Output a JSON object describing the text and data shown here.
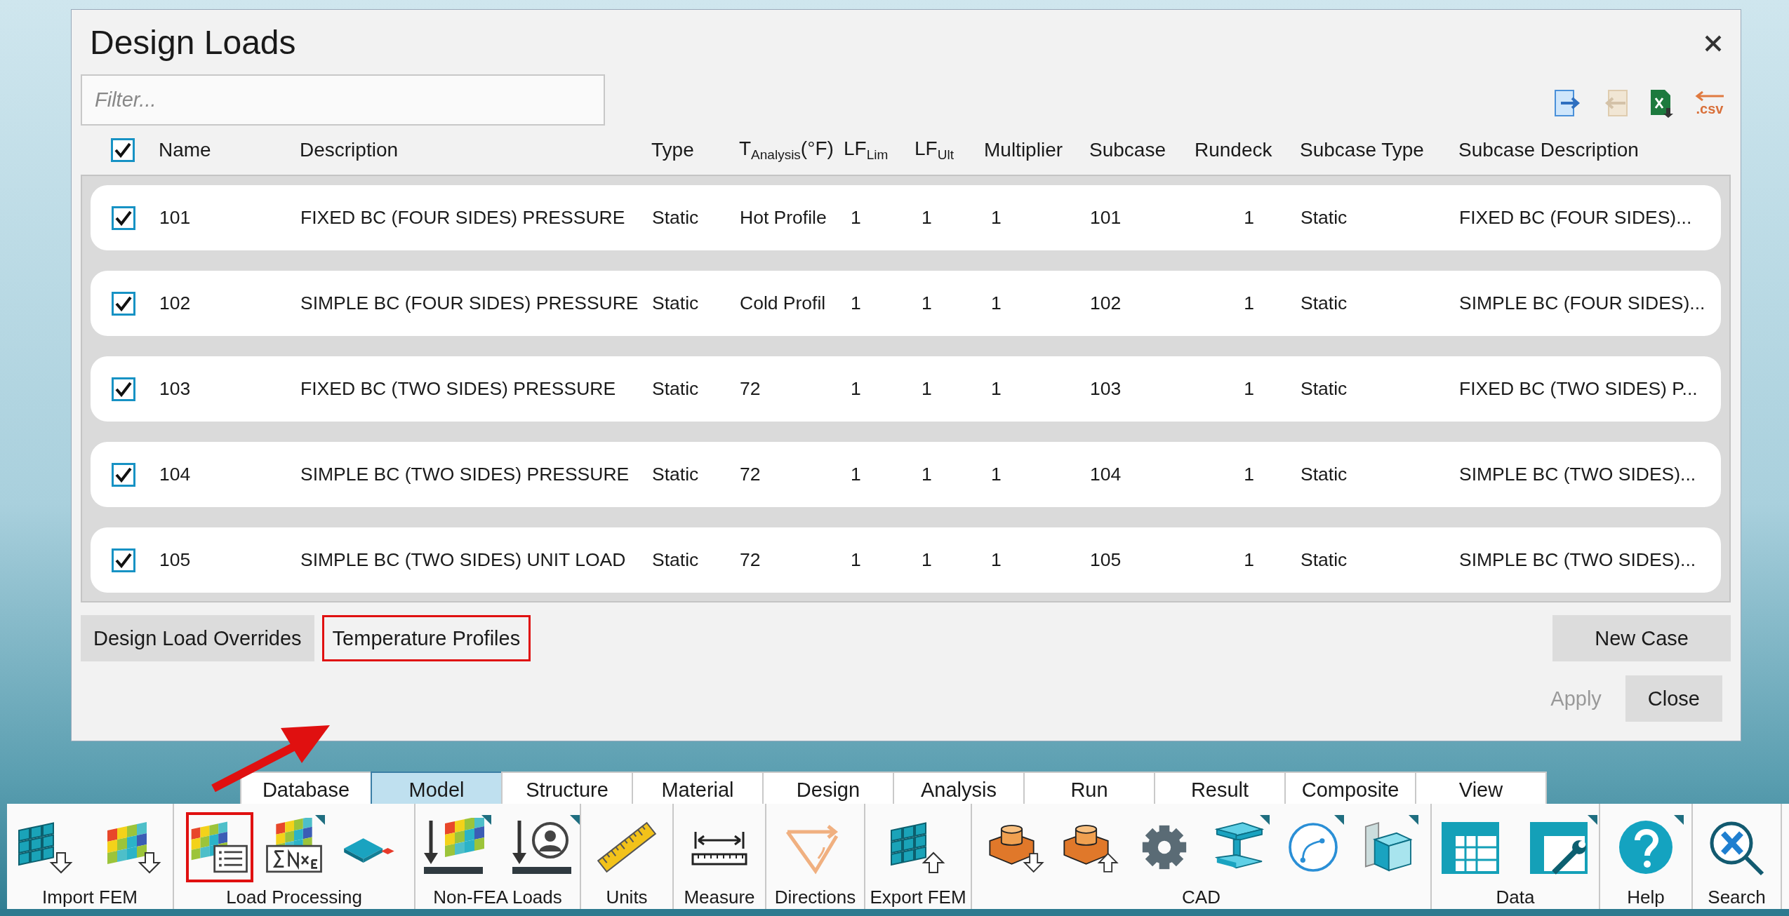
{
  "dialog": {
    "title": "Design Loads",
    "filter": {
      "placeholder": "Filter..."
    },
    "actions": [
      {
        "kind": "import",
        "disabled": false
      },
      {
        "kind": "export",
        "disabled": true
      },
      {
        "kind": "excel",
        "disabled": false
      },
      {
        "kind": "csv",
        "disabled": false,
        "label": ".csv"
      }
    ],
    "header_checked": true,
    "columns": [
      "Name",
      "Description",
      "Type",
      "T$_{Analysis}$(°F)",
      "LF$_{Lim}$",
      "LF$_{Ult}$",
      "Multiplier",
      "Subcase",
      "Rundeck",
      "Subcase Type",
      "Subcase Description"
    ],
    "rows": [
      {
        "checked": true,
        "cells": [
          "101",
          "FIXED BC (FOUR SIDES) PRESSURE",
          "Static",
          "Hot Profile",
          "1",
          "1",
          "1",
          "101",
          "1",
          "Static",
          "FIXED BC (FOUR SIDES)..."
        ]
      },
      {
        "checked": true,
        "cells": [
          "102",
          "SIMPLE BC (FOUR SIDES) PRESSURE",
          "Static",
          "Cold Profil",
          "1",
          "1",
          "1",
          "102",
          "1",
          "Static",
          "SIMPLE BC (FOUR SIDES)..."
        ]
      },
      {
        "checked": true,
        "cells": [
          "103",
          "FIXED BC (TWO SIDES) PRESSURE",
          "Static",
          "72",
          "1",
          "1",
          "1",
          "103",
          "1",
          "Static",
          "FIXED BC (TWO SIDES) P..."
        ]
      },
      {
        "checked": true,
        "cells": [
          "104",
          "SIMPLE BC (TWO SIDES) PRESSURE",
          "Static",
          "72",
          "1",
          "1",
          "1",
          "104",
          "1",
          "Static",
          "SIMPLE BC (TWO SIDES)..."
        ]
      },
      {
        "checked": true,
        "cells": [
          "105",
          "SIMPLE BC (TWO SIDES) UNIT LOAD",
          "Static",
          "72",
          "1",
          "1",
          "1",
          "105",
          "1",
          "Static",
          "SIMPLE BC (TWO SIDES)..."
        ]
      }
    ],
    "left_buttons": [
      {
        "label": "Design Load Overrides",
        "highlighted": false
      },
      {
        "label": "Temperature Profiles",
        "highlighted": true
      }
    ],
    "new_case": "New Case",
    "footer_buttons": [
      {
        "label": "Apply",
        "disabled": true
      },
      {
        "label": "Close",
        "disabled": false
      }
    ]
  },
  "ribbon": {
    "tabs": [
      {
        "label": "Database",
        "selected": false
      },
      {
        "label": "Model",
        "selected": true
      },
      {
        "label": "Structure",
        "selected": false
      },
      {
        "label": "Material",
        "selected": false
      },
      {
        "label": "Design",
        "selected": false
      },
      {
        "label": "Analysis",
        "selected": false
      },
      {
        "label": "Run",
        "selected": false
      },
      {
        "label": "Result",
        "selected": false
      },
      {
        "label": "Composite",
        "selected": false
      },
      {
        "label": "View",
        "selected": false
      }
    ],
    "groups": [
      {
        "label": "Import FEM",
        "tools": [
          {
            "kind": "grid-down",
            "menu": false,
            "highlighted": false
          },
          {
            "kind": "color-down",
            "menu": false,
            "highlighted": false
          }
        ]
      },
      {
        "label": "Load Processing",
        "tools": [
          {
            "kind": "color-list",
            "menu": false,
            "highlighted": true
          },
          {
            "kind": "sum",
            "menu": true,
            "highlighted": false
          },
          {
            "kind": "diamond",
            "menu": false,
            "highlighted": false
          }
        ]
      },
      {
        "label": "Non-FEA Loads",
        "tools": [
          {
            "kind": "load-grid",
            "menu": true,
            "highlighted": false
          },
          {
            "kind": "load-person",
            "menu": true,
            "highlighted": false
          }
        ]
      },
      {
        "label": "Units",
        "tools": [
          {
            "kind": "ruler",
            "menu": false,
            "highlighted": false
          }
        ]
      },
      {
        "label": "Measure",
        "tools": [
          {
            "kind": "measure",
            "menu": false,
            "highlighted": false
          }
        ]
      },
      {
        "label": "Directions",
        "tools": [
          {
            "kind": "directions",
            "menu": false,
            "highlighted": false
          }
        ]
      },
      {
        "label": "Export FEM",
        "tools": [
          {
            "kind": "grid-up",
            "menu": false,
            "highlighted": false
          }
        ]
      },
      {
        "label": "CAD",
        "tools": [
          {
            "kind": "cad-down",
            "menu": false,
            "highlighted": false
          },
          {
            "kind": "cad-up",
            "menu": false,
            "highlighted": false
          },
          {
            "kind": "gear",
            "menu": false,
            "highlighted": false
          },
          {
            "kind": "ibeam",
            "menu": true,
            "highlighted": false
          },
          {
            "kind": "curve",
            "menu": true,
            "highlighted": false
          },
          {
            "kind": "solid",
            "menu": true,
            "highlighted": false
          }
        ]
      },
      {
        "label": "Data",
        "tools": [
          {
            "kind": "table",
            "menu": false,
            "highlighted": false
          },
          {
            "kind": "table-wrench",
            "menu": true,
            "highlighted": false
          }
        ]
      },
      {
        "label": "Help",
        "tools": [
          {
            "kind": "help",
            "menu": true,
            "highlighted": false
          }
        ]
      },
      {
        "label": "Search",
        "tools": [
          {
            "kind": "search",
            "menu": false,
            "highlighted": false
          }
        ]
      }
    ]
  },
  "annotation": {
    "kind": "arrow"
  }
}
